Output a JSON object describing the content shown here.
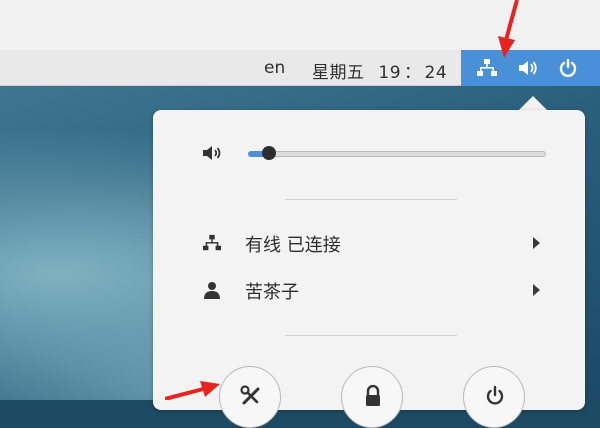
{
  "panel": {
    "language": "en",
    "day": "星期五",
    "time_hour": "19",
    "time_sep": "：",
    "time_min": "24",
    "status_bg": "#4a90d9",
    "status_icons": [
      "network-wired-icon",
      "volume-icon",
      "power-icon"
    ]
  },
  "menu": {
    "volume": {
      "icon": "volume-icon",
      "level_percent": 7
    },
    "network": {
      "icon": "network-wired-icon",
      "label": "有线 已连接"
    },
    "user": {
      "icon": "user-icon",
      "label": "苦茶子"
    },
    "buttons": [
      "settings-button",
      "lock-button",
      "power-off-button"
    ]
  },
  "annotation_color": "#e8231f",
  "accent_color": "#4a90d9"
}
